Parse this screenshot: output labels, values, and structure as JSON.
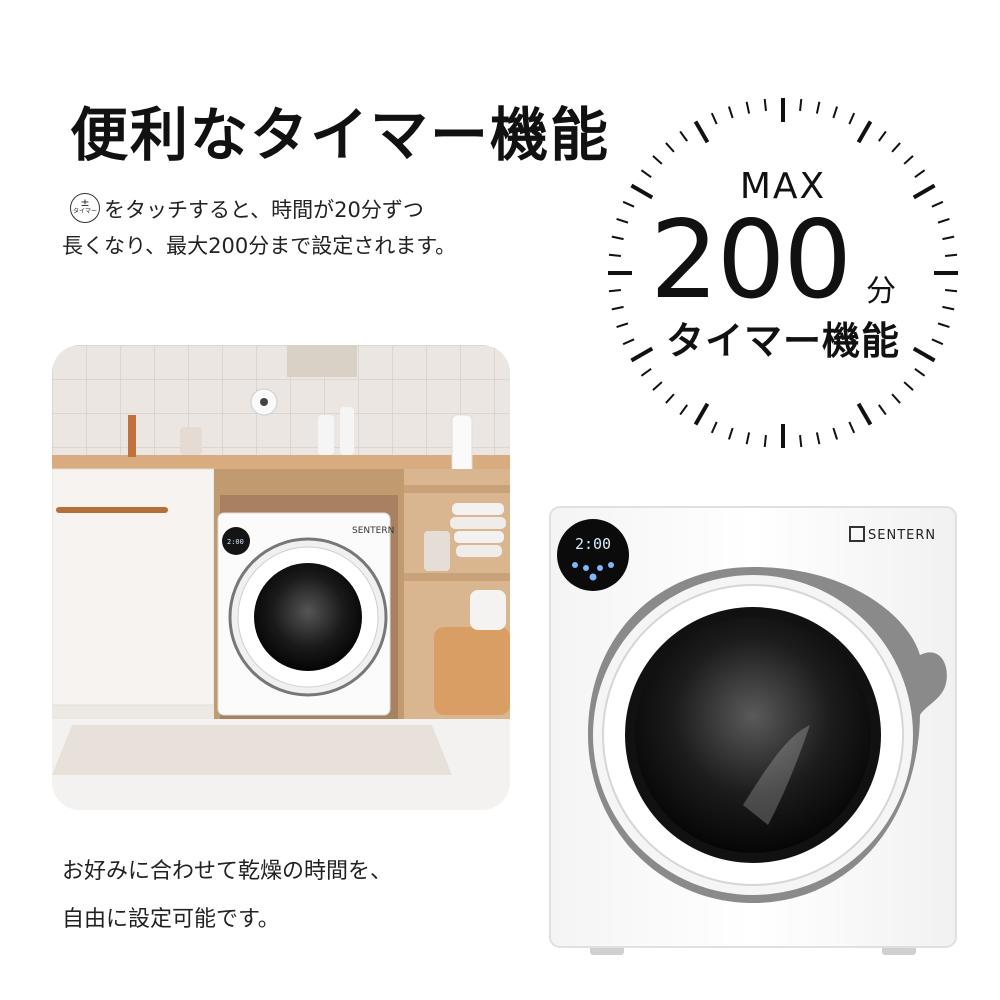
{
  "headline": "便利なタイマー機能",
  "description": {
    "icon_name": "timer-plus-minus-icon",
    "icon_symbol": "±",
    "icon_label": "タイマー",
    "line1_after_icon": "をタッチすると、時間が20分ずつ",
    "line2": "長くなり、最大200分まで設定されます。"
  },
  "dial": {
    "max_label": "MAX",
    "number": "200",
    "unit": "分",
    "subtitle": "タイマー機能"
  },
  "photo": {
    "brand": "SENTERN",
    "display": "2:00"
  },
  "caption": {
    "line1": "お好みに合わせて乾燥の時間を、",
    "line2": "自由に設定可能です。"
  },
  "product": {
    "brand": "SENTERN",
    "display": "2:00"
  }
}
